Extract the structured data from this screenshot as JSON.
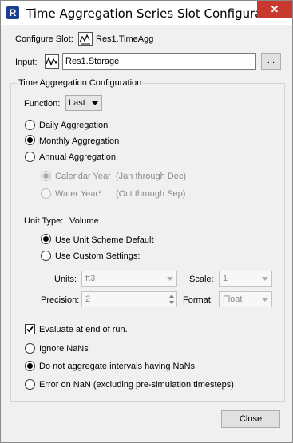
{
  "window": {
    "title": "Time Aggregation Series Slot Configuration",
    "close_glyph": "✕",
    "app_icon_letter": "R"
  },
  "slot": {
    "label": "Configure Slot:",
    "value": "Res1.TimeAgg"
  },
  "input": {
    "label": "Input:",
    "value": "Res1.Storage",
    "browse_label": "..."
  },
  "config": {
    "group_title": "Time Aggregation Configuration",
    "function_label": "Function:",
    "function_value": "Last",
    "aggregation_options": [
      "Daily Aggregation",
      "Monthly Aggregation",
      "Annual Aggregation:"
    ],
    "selected_aggregation": "Monthly Aggregation",
    "year_options": [
      {
        "label": "Calendar Year",
        "note": "(Jan through Dec)"
      },
      {
        "label": "Water Year*",
        "note": "(Oct through Sep)"
      }
    ],
    "unit_type_label": "Unit Type:",
    "unit_type_value": "Volume",
    "unit_options": [
      "Use Unit Scheme Default",
      "Use Custom Settings:"
    ],
    "units_label": "Units:",
    "units_value": "ft3",
    "scale_label": "Scale:",
    "scale_value": "1",
    "precision_label": "Precision:",
    "precision_value": "2",
    "format_label": "Format:",
    "format_value": "Float",
    "evaluate_label": "Evaluate at end of run.",
    "evaluate_checked": true,
    "nan_options": [
      "Ignore NaNs",
      "Do not aggregate intervals having NaNs",
      "Error on NaN  (excluding pre-simulation timesteps)"
    ],
    "selected_nan": "Do not aggregate intervals having NaNs"
  },
  "footer": {
    "close_label": "Close"
  },
  "colors": {
    "accent": "#1b3f91",
    "close_button": "#c7382f"
  }
}
